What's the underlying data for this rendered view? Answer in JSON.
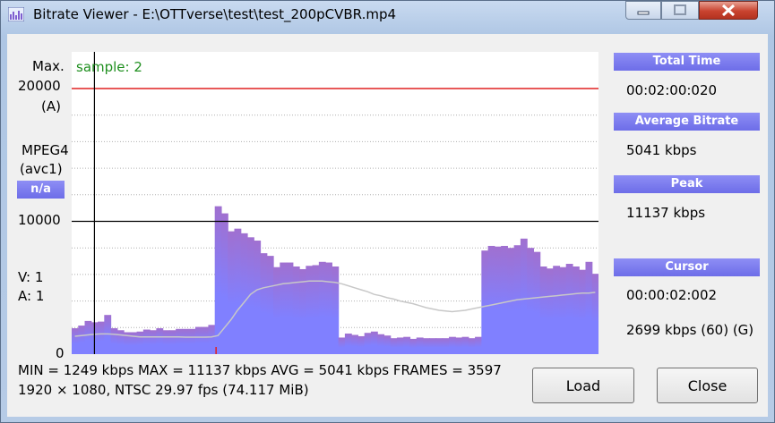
{
  "window": {
    "title": "Bitrate Viewer - E:\\OTTverse\\test\\test_200pCVBR.mp4"
  },
  "left_axis": {
    "max_label": "Max.",
    "max_value": "20000",
    "max_mode": "(A)",
    "codec": "MPEG4",
    "codec_tag": "(avc1)",
    "na_badge": "n/a",
    "mid_value": "10000",
    "v_label": "V:  1",
    "a_label": "A:  1",
    "zero": "0"
  },
  "chart": {
    "sample_label": "sample: 2"
  },
  "chart_data": {
    "type": "bar",
    "ylim": [
      0,
      20000
    ],
    "max_line": 20000,
    "gridline_mid": 10000,
    "grid": true,
    "cursor_index": 3,
    "red_marker_index": 22,
    "values": [
      1950,
      2150,
      2500,
      2400,
      2450,
      2950,
      1950,
      1800,
      1650,
      1650,
      1700,
      1850,
      1800,
      1950,
      1800,
      1800,
      1900,
      1900,
      1900,
      2050,
      2050,
      2200,
      11137,
      10600,
      9250,
      9450,
      9100,
      8800,
      8550,
      7600,
      7400,
      6550,
      6900,
      6900,
      6600,
      6400,
      6650,
      6700,
      6950,
      6900,
      6600,
      1249,
      1550,
      1450,
      1350,
      1600,
      1700,
      1500,
      1400,
      1200,
      1250,
      1300,
      1150,
      1250,
      1200,
      1200,
      1200,
      1200,
      1300,
      1250,
      1300,
      1200,
      1300,
      7800,
      8150,
      8100,
      8150,
      8000,
      8200,
      8700,
      8000,
      7700,
      6600,
      6450,
      6650,
      6550,
      6800,
      6600,
      6350,
      6950,
      6050
    ],
    "avg_curve": [
      1350,
      1400,
      1450,
      1500,
      1520,
      1520,
      1500,
      1450,
      1400,
      1350,
      1300,
      1300,
      1300,
      1300,
      1300,
      1300,
      1300,
      1280,
      1280,
      1280,
      1280,
      1300,
      1400,
      2000,
      2600,
      3300,
      3900,
      4500,
      4850,
      5000,
      5100,
      5200,
      5300,
      5350,
      5400,
      5450,
      5500,
      5500,
      5500,
      5450,
      5400,
      5300,
      5150,
      5000,
      4850,
      4700,
      4500,
      4400,
      4250,
      4150,
      4000,
      3900,
      3800,
      3650,
      3500,
      3400,
      3300,
      3250,
      3200,
      3250,
      3300,
      3400,
      3500,
      3600,
      3700,
      3800,
      3900,
      4000,
      4100,
      4150,
      4200,
      4250,
      4300,
      4350,
      4400,
      4450,
      4500,
      4550,
      4600,
      4600,
      4650
    ]
  },
  "side": {
    "total_time_label": "Total Time",
    "total_time": "00:02:00:020",
    "avg_bitrate_label": "Average Bitrate",
    "avg_bitrate": "5041 kbps",
    "peak_label": "Peak",
    "peak": "11137 kbps",
    "cursor_label": "Cursor",
    "cursor_time": "00:00:02:002",
    "cursor_value": "2699 kbps (60)    (G)"
  },
  "stats": {
    "line1": "MIN = 1249 kbps  MAX = 11137 kbps  AVG = 5041 kbps  FRAMES = 3597",
    "line2": "1920 × 1080, NTSC 29.97 fps        (74.117 MiB)"
  },
  "buttons": {
    "load": "Load",
    "close": "Close"
  },
  "colors": {
    "bar": "#8080ff",
    "bar_top": "#a070d0",
    "max_line": "#e02020",
    "sample_text": "#1f8f1f"
  }
}
